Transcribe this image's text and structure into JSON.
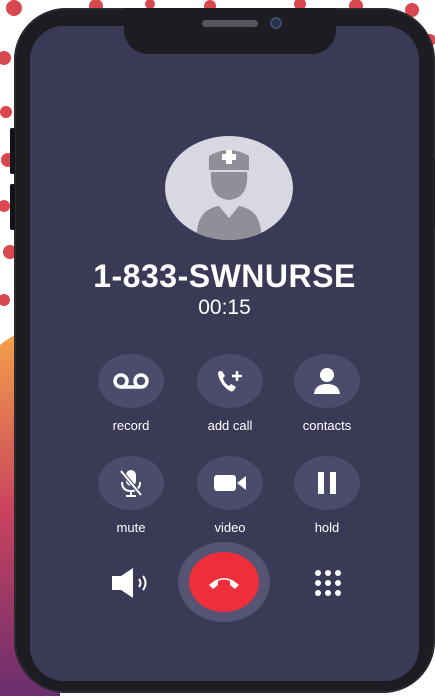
{
  "call": {
    "caller": "1-833-SWNURSE",
    "duration": "00:15"
  },
  "controls": [
    {
      "label": "record",
      "icon": "voicemail-icon"
    },
    {
      "label": "add call",
      "icon": "add-call-icon"
    },
    {
      "label": "contacts",
      "icon": "person-icon"
    },
    {
      "label": "mute",
      "icon": "mic-muted-icon"
    },
    {
      "label": "video",
      "icon": "video-camera-icon"
    },
    {
      "label": "hold",
      "icon": "pause-icon"
    }
  ],
  "bottom_bar": {
    "left_icon": "speaker-icon",
    "center_icon": "end-call-icon",
    "right_icon": "keypad-icon"
  },
  "colors": {
    "screen": "#3a3a57",
    "control_circle": "#4b4b6c",
    "end_call": "#ee2e3a",
    "dots": "#d9474f"
  }
}
